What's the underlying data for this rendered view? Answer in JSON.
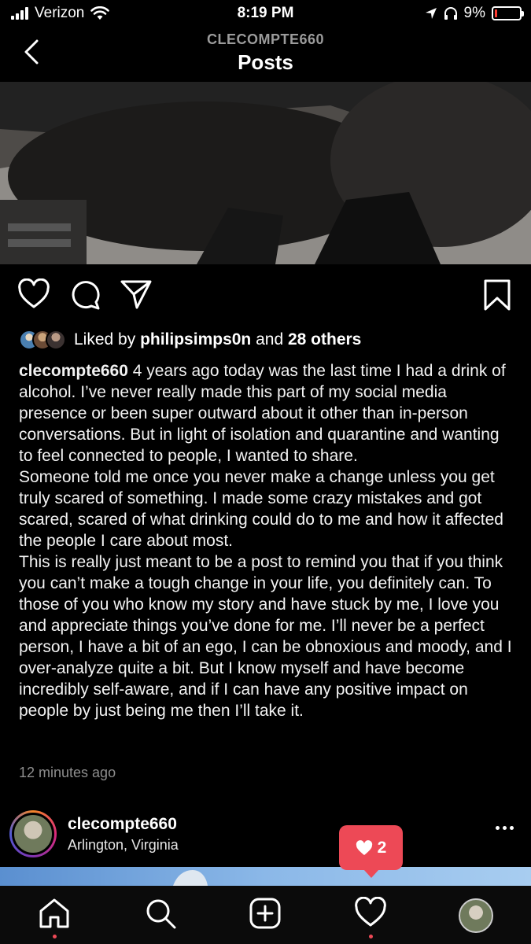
{
  "status_bar": {
    "carrier": "Verizon",
    "time": "8:19 PM",
    "battery_percent": "9%",
    "battery_level": 0.09,
    "battery_color": "#ff3b30"
  },
  "header": {
    "subtitle": "CLECOMPTE660",
    "title": "Posts",
    "back_icon": "chevron-left-icon"
  },
  "actions": {
    "icons": [
      "heart-icon",
      "comment-icon",
      "share-icon",
      "bookmark-icon"
    ]
  },
  "likes": {
    "prefix": "Liked by",
    "user": "philipsimps0n",
    "connector": "and",
    "others": "28 others"
  },
  "caption": {
    "username": "clecompte660",
    "paragraphs": [
      "4 years ago today was the last time I had a drink of alcohol. I’ve never really made this part of my social media presence or been super outward about it other than in-person conversations. But in light of isolation and quarantine and wanting to feel connected to people, I wanted to share.",
      "Someone told me once you never make a change unless you get truly scared of something. I made some crazy mistakes and got scared, scared of what drinking could do to me and how it affected the people I care about most.",
      "This is really just meant to be a post to remind you that if you think you can’t make a tough change in your life, you definitely can. To those of you who know my story and have stuck by me, I love you and appreciate things you’ve done for me. I’ll never be a perfect person, I have a bit of an ego, I can be obnoxious and moody, and I over-analyze quite a bit. But I know myself and have become incredibly self-aware, and  if I can have any positive impact on people by just being me then I’ll take it."
    ],
    "timestamp": "12 minutes ago"
  },
  "next_post": {
    "username": "clecompte660",
    "location": "Arlington, Virginia"
  },
  "notification": {
    "icon": "heart-icon",
    "count": "2",
    "color": "#ed4956"
  },
  "tabbar": {
    "tabs": [
      "home-icon",
      "search-icon",
      "new-post-icon",
      "activity-heart-icon",
      "profile-avatar"
    ]
  }
}
